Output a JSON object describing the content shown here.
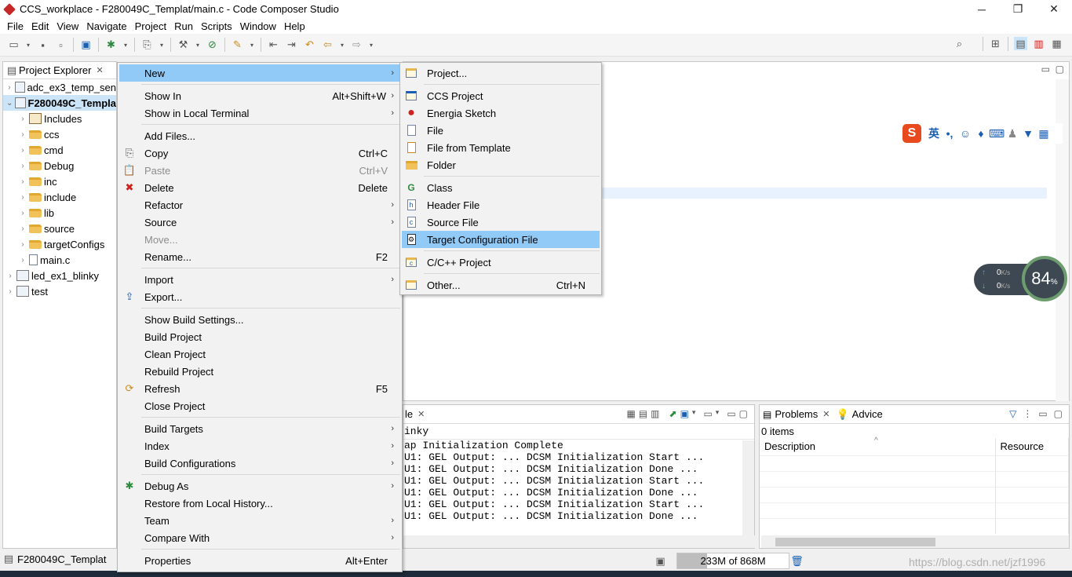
{
  "window": {
    "title": "CCS_workplace - F280049C_Templat/main.c - Code Composer Studio",
    "minimize_glyph": "─",
    "restore_glyph": "❐",
    "close_glyph": "✕"
  },
  "menubar": [
    "File",
    "Edit",
    "View",
    "Navigate",
    "Project",
    "Run",
    "Scripts",
    "Window",
    "Help"
  ],
  "explorer": {
    "title": "Project Explorer",
    "close_glyph": "✕",
    "items": [
      {
        "label": "adc_ex3_temp_sen",
        "level": 0,
        "arrow": "›",
        "icon": "project-icon"
      },
      {
        "label": "F280049C_Templa",
        "level": 0,
        "arrow": "⌄",
        "icon": "project-icon",
        "selected": true
      },
      {
        "label": "Includes",
        "level": 1,
        "arrow": "›",
        "icon": "includes-icon"
      },
      {
        "label": "ccs",
        "level": 1,
        "arrow": "›",
        "icon": "folder-icon"
      },
      {
        "label": "cmd",
        "level": 1,
        "arrow": "›",
        "icon": "folder-icon"
      },
      {
        "label": "Debug",
        "level": 1,
        "arrow": "›",
        "icon": "folder-icon"
      },
      {
        "label": "inc",
        "level": 1,
        "arrow": "›",
        "icon": "folder-icon"
      },
      {
        "label": "include",
        "level": 1,
        "arrow": "›",
        "icon": "folder-icon"
      },
      {
        "label": "lib",
        "level": 1,
        "arrow": "›",
        "icon": "folder-icon"
      },
      {
        "label": "source",
        "level": 1,
        "arrow": "›",
        "icon": "folder-icon"
      },
      {
        "label": "targetConfigs",
        "level": 1,
        "arrow": "›",
        "icon": "folder-icon"
      },
      {
        "label": "main.c",
        "level": 1,
        "arrow": "›",
        "icon": "c-file-icon"
      },
      {
        "label": "led_ex1_blinky",
        "level": 0,
        "arrow": "›",
        "icon": "project-icon"
      },
      {
        "label": "test",
        "level": 0,
        "arrow": "›",
        "icon": "project-icon"
      }
    ],
    "footer_label": "F280049C_Templat"
  },
  "context_menu": {
    "items": [
      {
        "label": "New",
        "submenu": true,
        "highlighted": true
      },
      {
        "separator": true
      },
      {
        "label": "Show In",
        "accel": "Alt+Shift+W",
        "submenu": true
      },
      {
        "label": "Show in Local Terminal",
        "submenu": true
      },
      {
        "separator": true
      },
      {
        "label": "Add Files..."
      },
      {
        "label": "Copy",
        "accel": "Ctrl+C",
        "icon": "copy-icon"
      },
      {
        "label": "Paste",
        "accel": "Ctrl+V",
        "icon": "paste-icon",
        "disabled": true
      },
      {
        "label": "Delete",
        "accel": "Delete",
        "icon": "delete-icon"
      },
      {
        "label": "Refactor",
        "submenu": true
      },
      {
        "label": "Source",
        "submenu": true
      },
      {
        "label": "Move...",
        "disabled": true
      },
      {
        "label": "Rename...",
        "accel": "F2"
      },
      {
        "separator": true
      },
      {
        "label": "Import",
        "submenu": true
      },
      {
        "label": "Export...",
        "icon": "export-icon"
      },
      {
        "separator": true
      },
      {
        "label": "Show Build Settings..."
      },
      {
        "label": "Build Project"
      },
      {
        "label": "Clean Project"
      },
      {
        "label": "Rebuild Project"
      },
      {
        "label": "Refresh",
        "accel": "F5",
        "icon": "refresh-icon"
      },
      {
        "label": "Close Project"
      },
      {
        "separator": true
      },
      {
        "label": "Build Targets",
        "submenu": true
      },
      {
        "label": "Index",
        "submenu": true
      },
      {
        "label": "Build Configurations",
        "submenu": true
      },
      {
        "separator": true
      },
      {
        "label": "Debug As",
        "submenu": true,
        "icon": "debug-icon"
      },
      {
        "label": "Restore from Local History..."
      },
      {
        "label": "Team",
        "submenu": true
      },
      {
        "label": "Compare With",
        "submenu": true
      },
      {
        "separator": true
      },
      {
        "label": "Properties",
        "accel": "Alt+Enter"
      }
    ]
  },
  "new_submenu": {
    "items": [
      {
        "label": "Project...",
        "icon": "new-project-icon"
      },
      {
        "separator": true
      },
      {
        "label": "CCS Project",
        "icon": "ccs-project-icon"
      },
      {
        "label": "Energia Sketch",
        "icon": "energia-icon"
      },
      {
        "label": "File",
        "icon": "new-file-icon"
      },
      {
        "label": "File from Template",
        "icon": "file-template-icon"
      },
      {
        "label": "Folder",
        "icon": "new-folder-icon"
      },
      {
        "separator": true
      },
      {
        "label": "Class",
        "icon": "class-icon"
      },
      {
        "label": "Header File",
        "icon": "header-file-icon"
      },
      {
        "label": "Source File",
        "icon": "source-file-icon"
      },
      {
        "label": "Target Configuration File",
        "icon": "target-config-icon",
        "highlighted": true
      },
      {
        "separator": true
      },
      {
        "label": "C/C++ Project",
        "icon": "cpp-project-icon"
      },
      {
        "separator": true
      },
      {
        "label": "Other...",
        "accel": "Ctrl+N",
        "icon": "other-icon"
      }
    ]
  },
  "console": {
    "tab_label": "le",
    "close_glyph": "✕",
    "subtitle": "inky",
    "lines": [
      "ap Initialization Complete",
      "U1: GEL Output: ... DCSM Initialization Start ...",
      "U1: GEL Output: ... DCSM Initialization Done ...",
      "U1: GEL Output: ... DCSM Initialization Start ...",
      "U1: GEL Output: ... DCSM Initialization Done ...",
      "U1: GEL Output: ... DCSM Initialization Start ...",
      "U1: GEL Output: ... DCSM Initialization Done ..."
    ]
  },
  "problems": {
    "tab_label": "Problems",
    "advice_label": "Advice",
    "close_glyph": "✕",
    "count": "0 items",
    "columns": [
      "Description",
      "Resource"
    ],
    "sort_glyph": "^"
  },
  "ime": {
    "lang": "英",
    "punct": "•,"
  },
  "net_widget": {
    "up": "0",
    "down": "0",
    "unit": "K/s",
    "percent": "84",
    "percent_sign": "%"
  },
  "status": {
    "heap": "233M of 868M",
    "heap_used_fraction": 0.27,
    "watermark": "https://blog.csdn.net/jzf1996"
  },
  "colors": {
    "menu_highlight": "#91c9f7",
    "selection": "#cce4f7",
    "accent_red": "#d0211c"
  }
}
